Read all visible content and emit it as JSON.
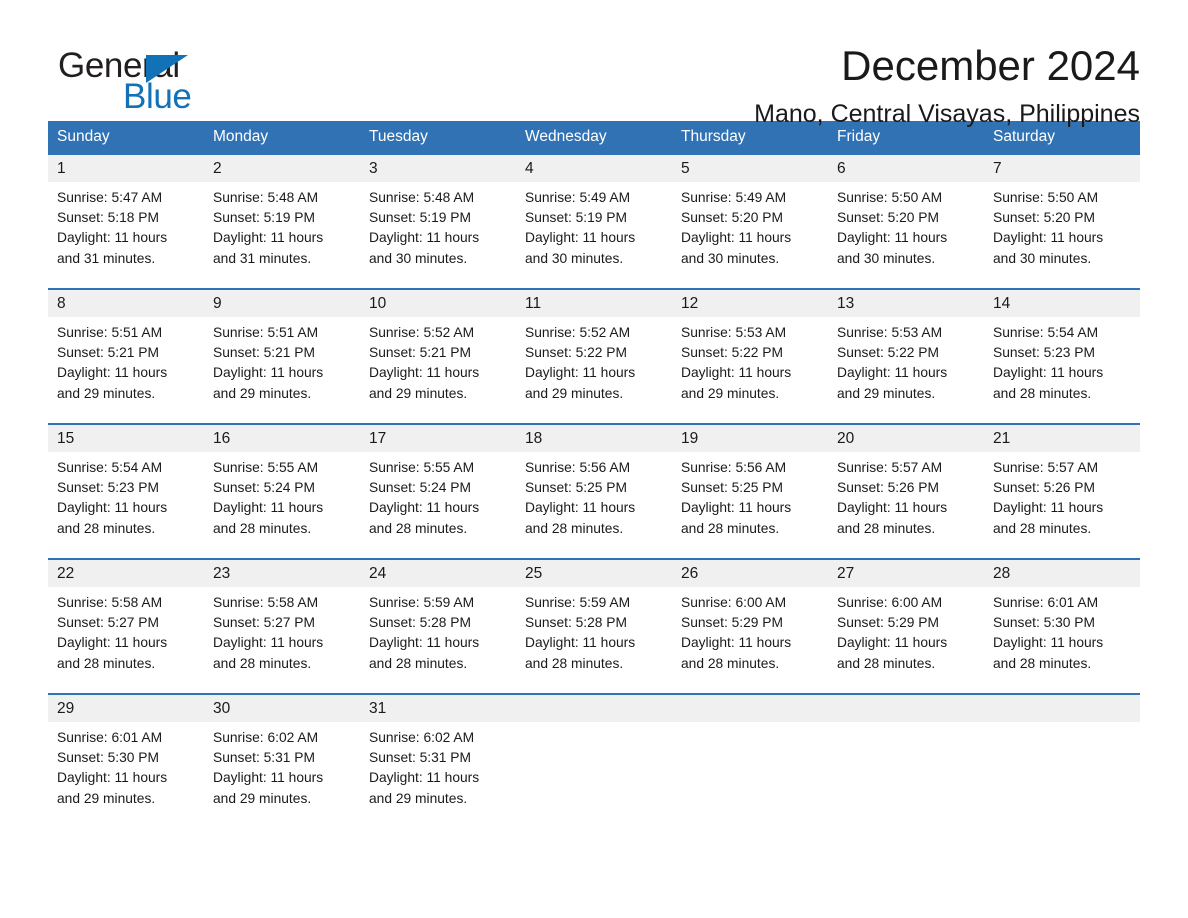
{
  "logo": {
    "word_one": "General",
    "word_two": "Blue",
    "triangle_icon": "triangle-icon",
    "brand_blue": "#1272b8",
    "brand_black": "#231f20"
  },
  "header": {
    "month_title": "December 2024",
    "location": "Mano, Central Visayas, Philippines"
  },
  "theme": {
    "header_blue": "#3072b3",
    "daynum_band": "#f0f0f0",
    "text": "#1a1a1a"
  },
  "weekdays": [
    "Sunday",
    "Monday",
    "Tuesday",
    "Wednesday",
    "Thursday",
    "Friday",
    "Saturday"
  ],
  "weeks": [
    {
      "numbers": [
        "1",
        "2",
        "3",
        "4",
        "5",
        "6",
        "7"
      ],
      "cells": [
        {
          "sunrise": "Sunrise: 5:47 AM",
          "sunset": "Sunset: 5:18 PM",
          "daylight_1": "Daylight: 11 hours",
          "daylight_2": "and 31 minutes."
        },
        {
          "sunrise": "Sunrise: 5:48 AM",
          "sunset": "Sunset: 5:19 PM",
          "daylight_1": "Daylight: 11 hours",
          "daylight_2": "and 31 minutes."
        },
        {
          "sunrise": "Sunrise: 5:48 AM",
          "sunset": "Sunset: 5:19 PM",
          "daylight_1": "Daylight: 11 hours",
          "daylight_2": "and 30 minutes."
        },
        {
          "sunrise": "Sunrise: 5:49 AM",
          "sunset": "Sunset: 5:19 PM",
          "daylight_1": "Daylight: 11 hours",
          "daylight_2": "and 30 minutes."
        },
        {
          "sunrise": "Sunrise: 5:49 AM",
          "sunset": "Sunset: 5:20 PM",
          "daylight_1": "Daylight: 11 hours",
          "daylight_2": "and 30 minutes."
        },
        {
          "sunrise": "Sunrise: 5:50 AM",
          "sunset": "Sunset: 5:20 PM",
          "daylight_1": "Daylight: 11 hours",
          "daylight_2": "and 30 minutes."
        },
        {
          "sunrise": "Sunrise: 5:50 AM",
          "sunset": "Sunset: 5:20 PM",
          "daylight_1": "Daylight: 11 hours",
          "daylight_2": "and 30 minutes."
        }
      ]
    },
    {
      "numbers": [
        "8",
        "9",
        "10",
        "11",
        "12",
        "13",
        "14"
      ],
      "cells": [
        {
          "sunrise": "Sunrise: 5:51 AM",
          "sunset": "Sunset: 5:21 PM",
          "daylight_1": "Daylight: 11 hours",
          "daylight_2": "and 29 minutes."
        },
        {
          "sunrise": "Sunrise: 5:51 AM",
          "sunset": "Sunset: 5:21 PM",
          "daylight_1": "Daylight: 11 hours",
          "daylight_2": "and 29 minutes."
        },
        {
          "sunrise": "Sunrise: 5:52 AM",
          "sunset": "Sunset: 5:21 PM",
          "daylight_1": "Daylight: 11 hours",
          "daylight_2": "and 29 minutes."
        },
        {
          "sunrise": "Sunrise: 5:52 AM",
          "sunset": "Sunset: 5:22 PM",
          "daylight_1": "Daylight: 11 hours",
          "daylight_2": "and 29 minutes."
        },
        {
          "sunrise": "Sunrise: 5:53 AM",
          "sunset": "Sunset: 5:22 PM",
          "daylight_1": "Daylight: 11 hours",
          "daylight_2": "and 29 minutes."
        },
        {
          "sunrise": "Sunrise: 5:53 AM",
          "sunset": "Sunset: 5:22 PM",
          "daylight_1": "Daylight: 11 hours",
          "daylight_2": "and 29 minutes."
        },
        {
          "sunrise": "Sunrise: 5:54 AM",
          "sunset": "Sunset: 5:23 PM",
          "daylight_1": "Daylight: 11 hours",
          "daylight_2": "and 28 minutes."
        }
      ]
    },
    {
      "numbers": [
        "15",
        "16",
        "17",
        "18",
        "19",
        "20",
        "21"
      ],
      "cells": [
        {
          "sunrise": "Sunrise: 5:54 AM",
          "sunset": "Sunset: 5:23 PM",
          "daylight_1": "Daylight: 11 hours",
          "daylight_2": "and 28 minutes."
        },
        {
          "sunrise": "Sunrise: 5:55 AM",
          "sunset": "Sunset: 5:24 PM",
          "daylight_1": "Daylight: 11 hours",
          "daylight_2": "and 28 minutes."
        },
        {
          "sunrise": "Sunrise: 5:55 AM",
          "sunset": "Sunset: 5:24 PM",
          "daylight_1": "Daylight: 11 hours",
          "daylight_2": "and 28 minutes."
        },
        {
          "sunrise": "Sunrise: 5:56 AM",
          "sunset": "Sunset: 5:25 PM",
          "daylight_1": "Daylight: 11 hours",
          "daylight_2": "and 28 minutes."
        },
        {
          "sunrise": "Sunrise: 5:56 AM",
          "sunset": "Sunset: 5:25 PM",
          "daylight_1": "Daylight: 11 hours",
          "daylight_2": "and 28 minutes."
        },
        {
          "sunrise": "Sunrise: 5:57 AM",
          "sunset": "Sunset: 5:26 PM",
          "daylight_1": "Daylight: 11 hours",
          "daylight_2": "and 28 minutes."
        },
        {
          "sunrise": "Sunrise: 5:57 AM",
          "sunset": "Sunset: 5:26 PM",
          "daylight_1": "Daylight: 11 hours",
          "daylight_2": "and 28 minutes."
        }
      ]
    },
    {
      "numbers": [
        "22",
        "23",
        "24",
        "25",
        "26",
        "27",
        "28"
      ],
      "cells": [
        {
          "sunrise": "Sunrise: 5:58 AM",
          "sunset": "Sunset: 5:27 PM",
          "daylight_1": "Daylight: 11 hours",
          "daylight_2": "and 28 minutes."
        },
        {
          "sunrise": "Sunrise: 5:58 AM",
          "sunset": "Sunset: 5:27 PM",
          "daylight_1": "Daylight: 11 hours",
          "daylight_2": "and 28 minutes."
        },
        {
          "sunrise": "Sunrise: 5:59 AM",
          "sunset": "Sunset: 5:28 PM",
          "daylight_1": "Daylight: 11 hours",
          "daylight_2": "and 28 minutes."
        },
        {
          "sunrise": "Sunrise: 5:59 AM",
          "sunset": "Sunset: 5:28 PM",
          "daylight_1": "Daylight: 11 hours",
          "daylight_2": "and 28 minutes."
        },
        {
          "sunrise": "Sunrise: 6:00 AM",
          "sunset": "Sunset: 5:29 PM",
          "daylight_1": "Daylight: 11 hours",
          "daylight_2": "and 28 minutes."
        },
        {
          "sunrise": "Sunrise: 6:00 AM",
          "sunset": "Sunset: 5:29 PM",
          "daylight_1": "Daylight: 11 hours",
          "daylight_2": "and 28 minutes."
        },
        {
          "sunrise": "Sunrise: 6:01 AM",
          "sunset": "Sunset: 5:30 PM",
          "daylight_1": "Daylight: 11 hours",
          "daylight_2": "and 28 minutes."
        }
      ]
    },
    {
      "numbers": [
        "29",
        "30",
        "31",
        "",
        "",
        "",
        ""
      ],
      "cells": [
        {
          "sunrise": "Sunrise: 6:01 AM",
          "sunset": "Sunset: 5:30 PM",
          "daylight_1": "Daylight: 11 hours",
          "daylight_2": "and 29 minutes."
        },
        {
          "sunrise": "Sunrise: 6:02 AM",
          "sunset": "Sunset: 5:31 PM",
          "daylight_1": "Daylight: 11 hours",
          "daylight_2": "and 29 minutes."
        },
        {
          "sunrise": "Sunrise: 6:02 AM",
          "sunset": "Sunset: 5:31 PM",
          "daylight_1": "Daylight: 11 hours",
          "daylight_2": "and 29 minutes."
        },
        {
          "sunrise": "",
          "sunset": "",
          "daylight_1": "",
          "daylight_2": ""
        },
        {
          "sunrise": "",
          "sunset": "",
          "daylight_1": "",
          "daylight_2": ""
        },
        {
          "sunrise": "",
          "sunset": "",
          "daylight_1": "",
          "daylight_2": ""
        },
        {
          "sunrise": "",
          "sunset": "",
          "daylight_1": "",
          "daylight_2": ""
        }
      ]
    }
  ]
}
